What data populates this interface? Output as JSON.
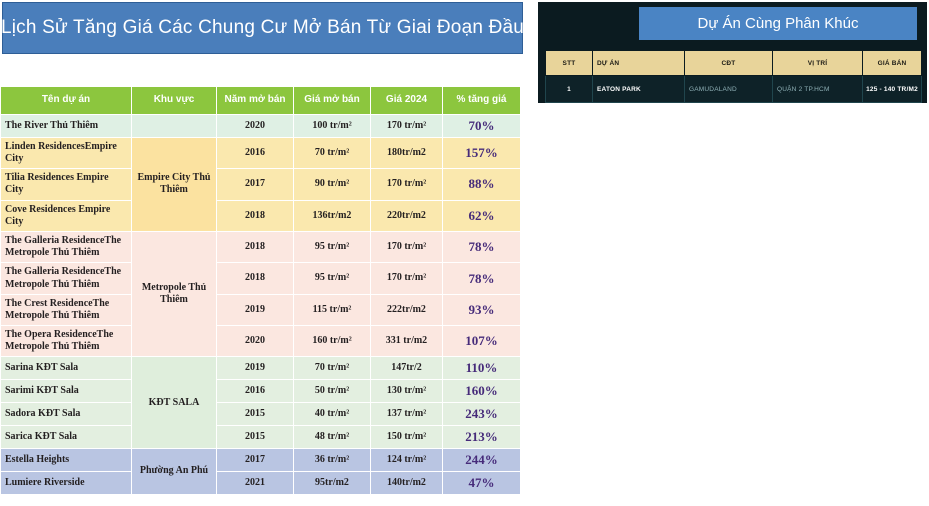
{
  "left": {
    "title": "Lịch Sử Tăng Giá Các Chung Cư Mở Bán Từ Giai Đoạn Đầu",
    "accent_color": "#4a7ebb",
    "header_color": "#8cc63e",
    "pct_color": "#462b7a",
    "table": {
      "columns": [
        "Tên dự án",
        "Khu vực",
        "Năm mở bán",
        "Giá mở bán",
        "Giá 2024",
        "% tăng giá"
      ],
      "groups": [
        {
          "area": "",
          "tint": "g-river",
          "area_tint": "area-river",
          "rows": [
            {
              "name": "The River Thủ Thiêm",
              "year": "2020",
              "open_price": "100 tr/m²",
              "price_2024": "170 tr/m²",
              "pct": "70%"
            }
          ]
        },
        {
          "area": "Empire City Thủ Thiêm",
          "tint": "g-empire",
          "area_tint": "area-empire",
          "rows": [
            {
              "name": "Linden ResidencesEmpire City",
              "year": "2016",
              "open_price": "70 tr/m²",
              "price_2024": "180tr/m2",
              "pct": "157%"
            },
            {
              "name": "Tilia Residences Empire City",
              "year": "2017",
              "open_price": "90 tr/m²",
              "price_2024": "170 tr/m²",
              "pct": "88%"
            },
            {
              "name": "Cove Residences Empire City",
              "year": "2018",
              "open_price": "136tr/m2",
              "price_2024": "220tr/m2",
              "pct": "62%"
            }
          ]
        },
        {
          "area": "Metropole Thủ Thiêm",
          "tint": "g-metro",
          "area_tint": "area-metro",
          "rows": [
            {
              "name": "The Galleria ResidenceThe Metropole Thủ Thiêm",
              "year": "2018",
              "open_price": "95 tr/m²",
              "price_2024": "170 tr/m²",
              "pct": "78%"
            },
            {
              "name": "The Galleria ResidenceThe Metropole Thủ Thiêm",
              "year": "2018",
              "open_price": "95 tr/m²",
              "price_2024": "170 tr/m²",
              "pct": "78%"
            },
            {
              "name": "The Crest ResidenceThe Metropole Thủ Thiêm",
              "year": "2019",
              "open_price": "115 tr/m²",
              "price_2024": "222tr/m2",
              "pct": "93%"
            },
            {
              "name": "The Opera ResidenceThe Metropole Thủ Thiêm",
              "year": "2020",
              "open_price": "160 tr/m²",
              "price_2024": "331 tr/m2",
              "pct": "107%"
            }
          ]
        },
        {
          "area": "KĐT SALA",
          "tint": "g-sala",
          "area_tint": "area-sala",
          "rows": [
            {
              "name": "Sarina KĐT Sala",
              "year": "2019",
              "open_price": "70 tr/m²",
              "price_2024": "147tr/2",
              "pct": "110%"
            },
            {
              "name": "Sarimi KĐT Sala",
              "year": "2016",
              "open_price": "50 tr/m²",
              "price_2024": "130 tr/m²",
              "pct": "160%"
            },
            {
              "name": "Sadora KĐT Sala",
              "year": "2015",
              "open_price": "40 tr/m²",
              "price_2024": "137 tr/m²",
              "pct": "243%"
            },
            {
              "name": "Sarica KĐT Sala",
              "year": "2015",
              "open_price": "48 tr/m²",
              "price_2024": "150 tr/m²",
              "pct": "213%"
            }
          ]
        },
        {
          "area": "Phường An Phú",
          "tint": "g-anphu",
          "area_tint": "area-anphu",
          "rows": [
            {
              "name": "Estella Heights",
              "year": "2017",
              "open_price": "36 tr/m²",
              "price_2024": "124 tr/m²",
              "pct": "244%"
            },
            {
              "name": "Lumiere Riverside",
              "year": "2021",
              "open_price": "95tr/m2",
              "price_2024": "140tr/m2",
              "pct": "47%"
            }
          ]
        }
      ]
    }
  },
  "right": {
    "title": "Dự Án Cùng Phân Khúc",
    "background_color": "#0b1b20",
    "title_color": "#4a84c4",
    "header_color": "#e8d49a",
    "table": {
      "columns": [
        "STT",
        "DỰ ÁN",
        "CĐT",
        "VỊ TRÍ",
        "GIÁ BÁN"
      ],
      "rows": [
        {
          "stt": "1",
          "project": "EATON PARK",
          "developer": "GAMUDALAND",
          "location": "QUẬN 2 TP.HCM",
          "price": "125 - 140 TR/M2"
        }
      ]
    }
  }
}
